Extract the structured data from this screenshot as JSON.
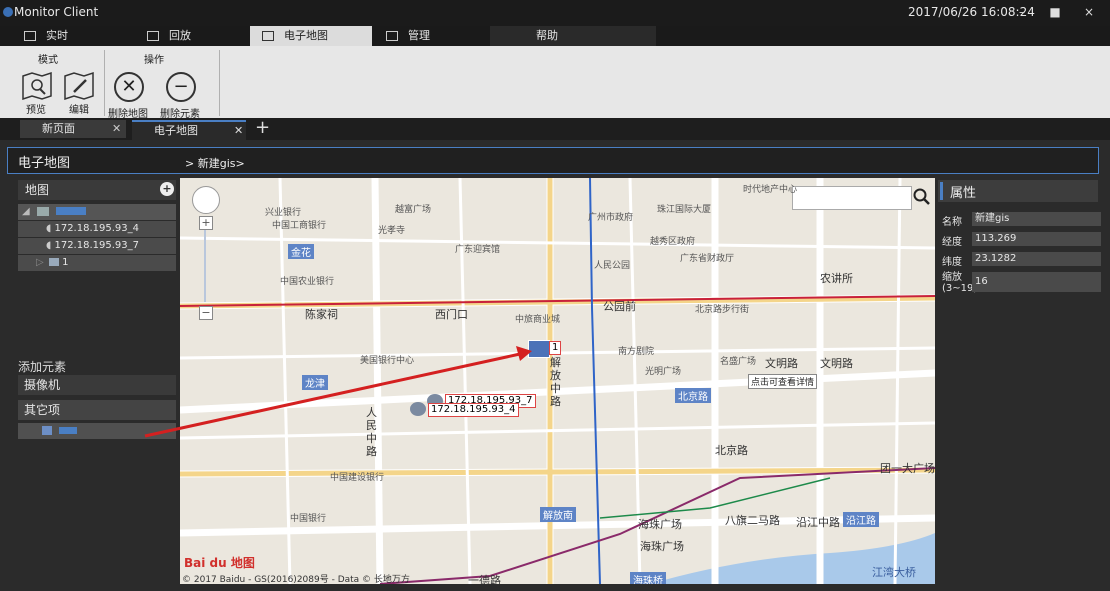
{
  "app": {
    "title": "Monitor Client",
    "datetime": "2017/06/26 16:08:24"
  },
  "main_tabs": [
    {
      "label": "实时"
    },
    {
      "label": "回放"
    },
    {
      "label": "电子地图"
    },
    {
      "label": "管理"
    },
    {
      "label": "帮助"
    }
  ],
  "ribbon": {
    "group_mode": "模式",
    "group_ops": "操作",
    "preview": "预览",
    "edit": "编辑",
    "delete_map": "删除地图",
    "delete_element": "删除元素"
  },
  "doc_tabs": [
    {
      "label": "新页面"
    },
    {
      "label": "电子地图"
    }
  ],
  "breadcrumb": {
    "title": "电子地图",
    "path": "> 新建gis>"
  },
  "left_panel": {
    "map_header": "地图",
    "tree": [
      "172.18.195.93_4",
      "172.18.195.93_7",
      "1"
    ],
    "add_element": "添加元素",
    "cameras": "摄像机",
    "others": "其它项"
  },
  "map": {
    "copyright": "© 2017 Baidu - GS(2016)2089号 - Data © 长地万方",
    "logo": "Bai du 地图",
    "marker_label": "1",
    "camera_labels": [
      "172.18.195.93_7",
      "172.18.195.93_4"
    ],
    "tooltip": "点击可查看详情",
    "labels": {
      "wenming": "文明路",
      "wenming2": "文明路",
      "jiefang": "解放中路",
      "renmin": "人民中路",
      "beijing": "北京路",
      "beijinglu": "北京路",
      "gongyuanqian": "公园前",
      "ximenkou": "西门口",
      "chenjiaci": "陈家祠",
      "nongjiangsuo": "农讲所",
      "haizhu": "海珠广场",
      "haizhu2": "海珠广场",
      "jinhua": "金花",
      "longjin": "龙津",
      "jiefangnan": "解放南",
      "yanjiang": "沿江中路",
      "yanjiangbox": "沿江路",
      "tuanyi": "团一大广场",
      "baqi": "八旗二马路",
      "haizhuqiao": "海珠桥",
      "jiangwan": "江湾大桥",
      "yidelu": "一德路",
      "shidai": "时代地产中心",
      "zhujiang": "珠江国际大厦",
      "guangzhouzf": "广州市政府",
      "yuexiu": "越秀区政府",
      "renmingy": "人民公园",
      "caizheng": "广东省财政厅",
      "beijingbx": "北京路步行街",
      "zhongguo_gs": "中国工商银行",
      "nongye": "中国农业银行",
      "jianshe": "中国建设银行",
      "zhongguoyh": "中国银行",
      "xingye": "兴业银行",
      "guanghua": "光孝寺",
      "yuehua": "越富广场",
      "yingbin": "广东迎宾馆",
      "nanfang": "南方剧院",
      "guangming": "光明广场",
      "mingsheng": "名盛广场",
      "zhongshan": "中旅商业城",
      "meiguo": "美国银行中心"
    }
  },
  "properties": {
    "header": "属性",
    "rows": [
      {
        "key": "名称",
        "value": "新建gis"
      },
      {
        "key": "经度",
        "value": "113.269"
      },
      {
        "key": "纬度",
        "value": "23.1282"
      },
      {
        "key": "缩放\n(3~19)",
        "value": "16"
      }
    ]
  },
  "colors": {
    "accent": "#4a7fc4",
    "metro_red": "#c8213a",
    "metro_blue": "#2f64c8",
    "arrow": "#d42020"
  }
}
